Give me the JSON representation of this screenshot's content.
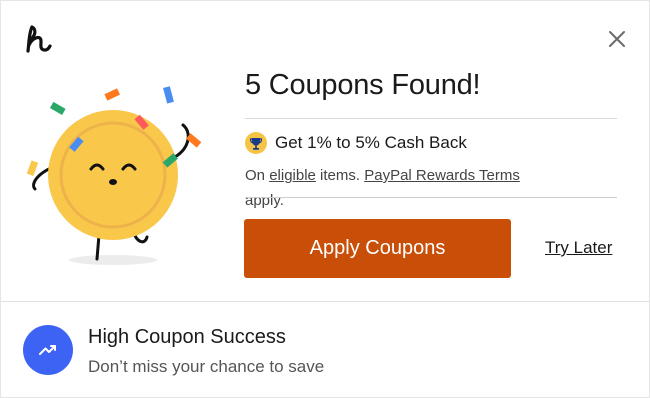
{
  "brand": {
    "logo_icon": "honey-h-logo-icon",
    "accent": "#c94e08",
    "blue": "#3d63f5"
  },
  "header": {
    "close_icon": "close-icon"
  },
  "main": {
    "title": "5 Coupons Found!",
    "cashback": {
      "icon": "trophy-icon",
      "text": "Get 1% to 5% Cash Back"
    },
    "terms": {
      "prefix": "On ",
      "eligible_link": "eligible",
      "middle": " items. ",
      "rewards_link": "PayPal Rewards Terms",
      "suffix": "apply."
    },
    "apply_button": "Apply Coupons",
    "try_later": "Try Later"
  },
  "footer": {
    "icon": "trending-up-icon",
    "title": "High Coupon Success",
    "subtitle": "Don’t miss your chance to save"
  }
}
